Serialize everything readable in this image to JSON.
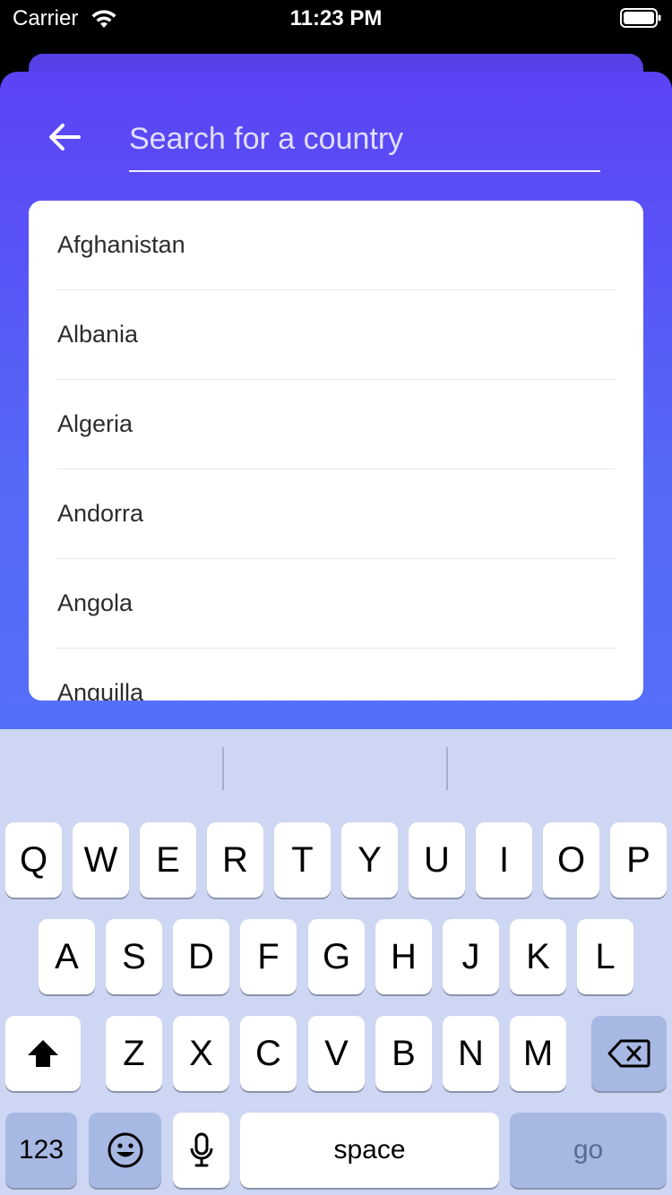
{
  "status_bar": {
    "carrier": "Carrier",
    "time": "11:23 PM"
  },
  "search": {
    "placeholder": "Search for a country",
    "value": ""
  },
  "countries": [
    "Afghanistan",
    "Albania",
    "Algeria",
    "Andorra",
    "Angola",
    "Anguilla"
  ],
  "keyboard": {
    "row1": [
      "Q",
      "W",
      "E",
      "R",
      "T",
      "Y",
      "U",
      "I",
      "O",
      "P"
    ],
    "row2": [
      "A",
      "S",
      "D",
      "F",
      "G",
      "H",
      "J",
      "K",
      "L"
    ],
    "row3": [
      "Z",
      "X",
      "C",
      "V",
      "B",
      "N",
      "M"
    ],
    "numbers_label": "123",
    "space_label": "space",
    "go_label": "go",
    "shift_icon": "shift-arrow-icon",
    "delete_icon": "backspace-icon",
    "emoji_icon": "emoji-icon",
    "mic_icon": "microphone-icon"
  },
  "colors": {
    "gradient_top": "#5b43f5",
    "gradient_bottom": "#5470fb",
    "keyboard_bg": "#cdd6f2"
  }
}
